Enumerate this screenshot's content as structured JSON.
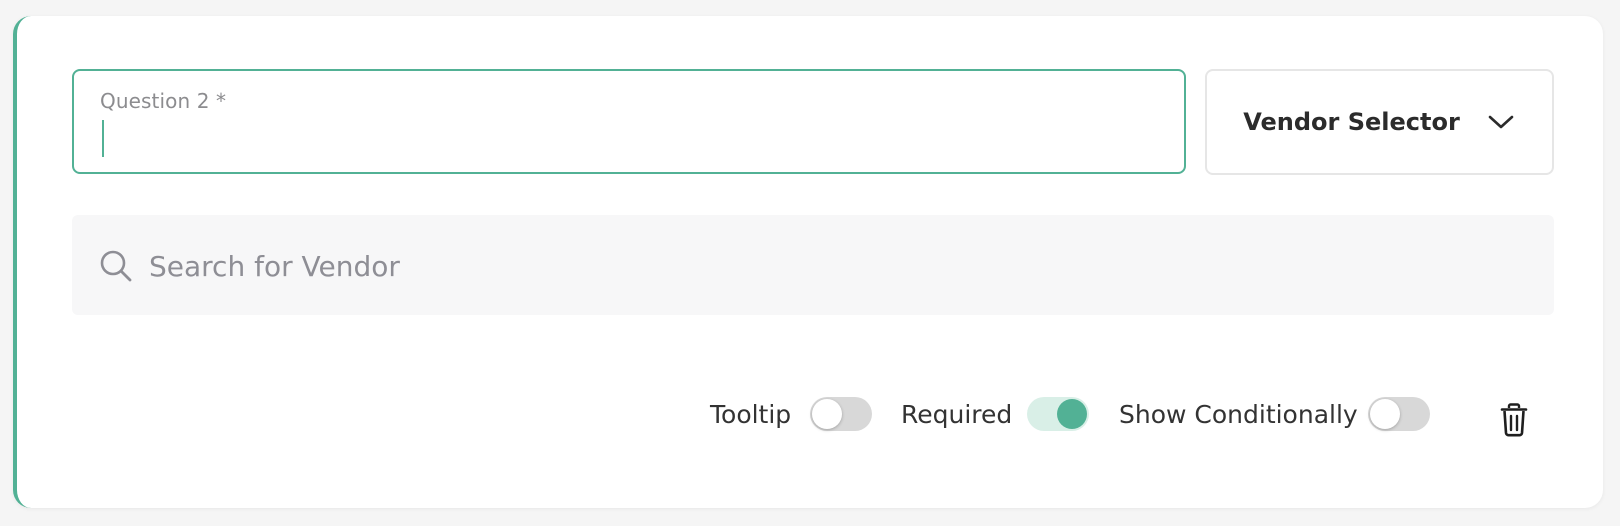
{
  "question": {
    "label": "Question 2 *",
    "value": "",
    "placeholder": ""
  },
  "vendor_selector": {
    "label": "Vendor Selector",
    "icon": "chevron-down-icon"
  },
  "search": {
    "placeholder": "Search for Vendor",
    "value": "",
    "icon": "search-icon"
  },
  "footer": {
    "tooltip": {
      "label": "Tooltip",
      "on": false
    },
    "required": {
      "label": "Required",
      "on": true
    },
    "show_conditionally": {
      "label": "Show Conditionally",
      "on": false
    },
    "delete_icon": "trash-icon"
  },
  "colors": {
    "accent": "#52b195",
    "toggle_on_track": "#d9efe7",
    "toggle_off_track": "#d8d8d8",
    "search_bg": "#f7f7f8"
  }
}
